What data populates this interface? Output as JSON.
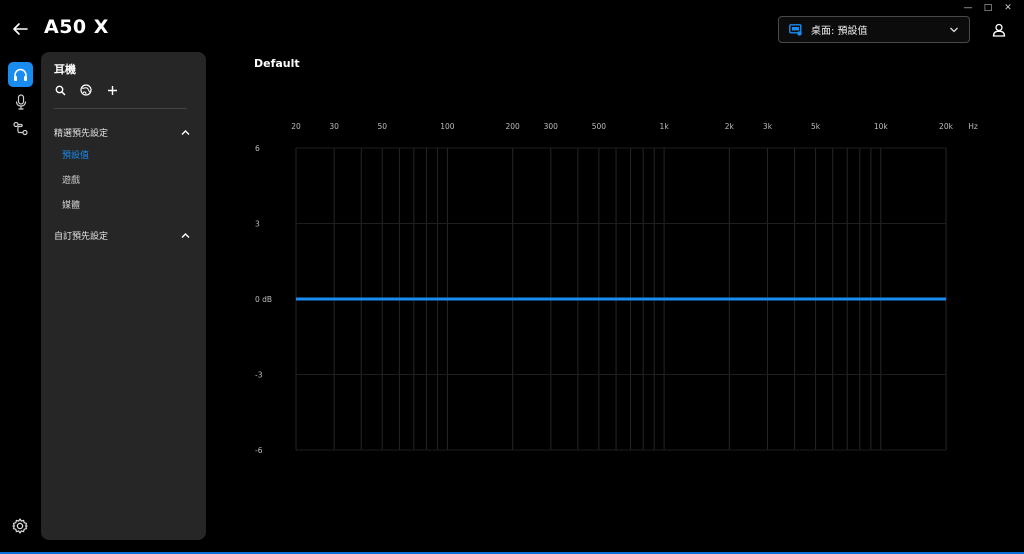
{
  "window_controls": {
    "minimize": "—",
    "maximize": "□",
    "close": "✕"
  },
  "header": {
    "title": "A50 X",
    "profile_selector": {
      "label": "桌面: 預設值"
    }
  },
  "icons": {
    "back": "back-arrow-icon",
    "headphones": "headphones-icon",
    "microphone": "microphone-icon",
    "routing": "routing-icon",
    "settings": "gear-icon",
    "user": "user-icon"
  },
  "panel": {
    "title": "耳機",
    "sections": [
      {
        "label": "精選預先設定",
        "expanded": true,
        "items": [
          "預設值",
          "遊戲",
          "媒體"
        ],
        "selected": "預設值"
      },
      {
        "label": "自訂預先設定",
        "expanded": true,
        "items": []
      }
    ]
  },
  "graph": {
    "title": "Default",
    "unit_x": "Hz",
    "accent_color": "#1a8cf0"
  },
  "chart_data": {
    "type": "line",
    "title": "Default",
    "x_scale": "log",
    "x_ticks": [
      "20",
      "30",
      "50",
      "100",
      "200",
      "300",
      "500",
      "1k",
      "2k",
      "3k",
      "5k",
      "10k",
      "20k"
    ],
    "x_tick_values": [
      20,
      30,
      50,
      100,
      200,
      300,
      500,
      1000,
      2000,
      3000,
      5000,
      10000,
      20000
    ],
    "x_unit": "Hz",
    "y_ticks": [
      "6",
      "3",
      "0 dB",
      "-3",
      "-6"
    ],
    "y_tick_values": [
      6,
      3,
      0,
      -3,
      -6
    ],
    "ylim": [
      -6,
      6
    ],
    "xlim": [
      20,
      20000
    ],
    "series": [
      {
        "x": [
          20,
          20000
        ],
        "y": [
          0,
          0
        ],
        "color": "#1a8cf0"
      }
    ]
  }
}
